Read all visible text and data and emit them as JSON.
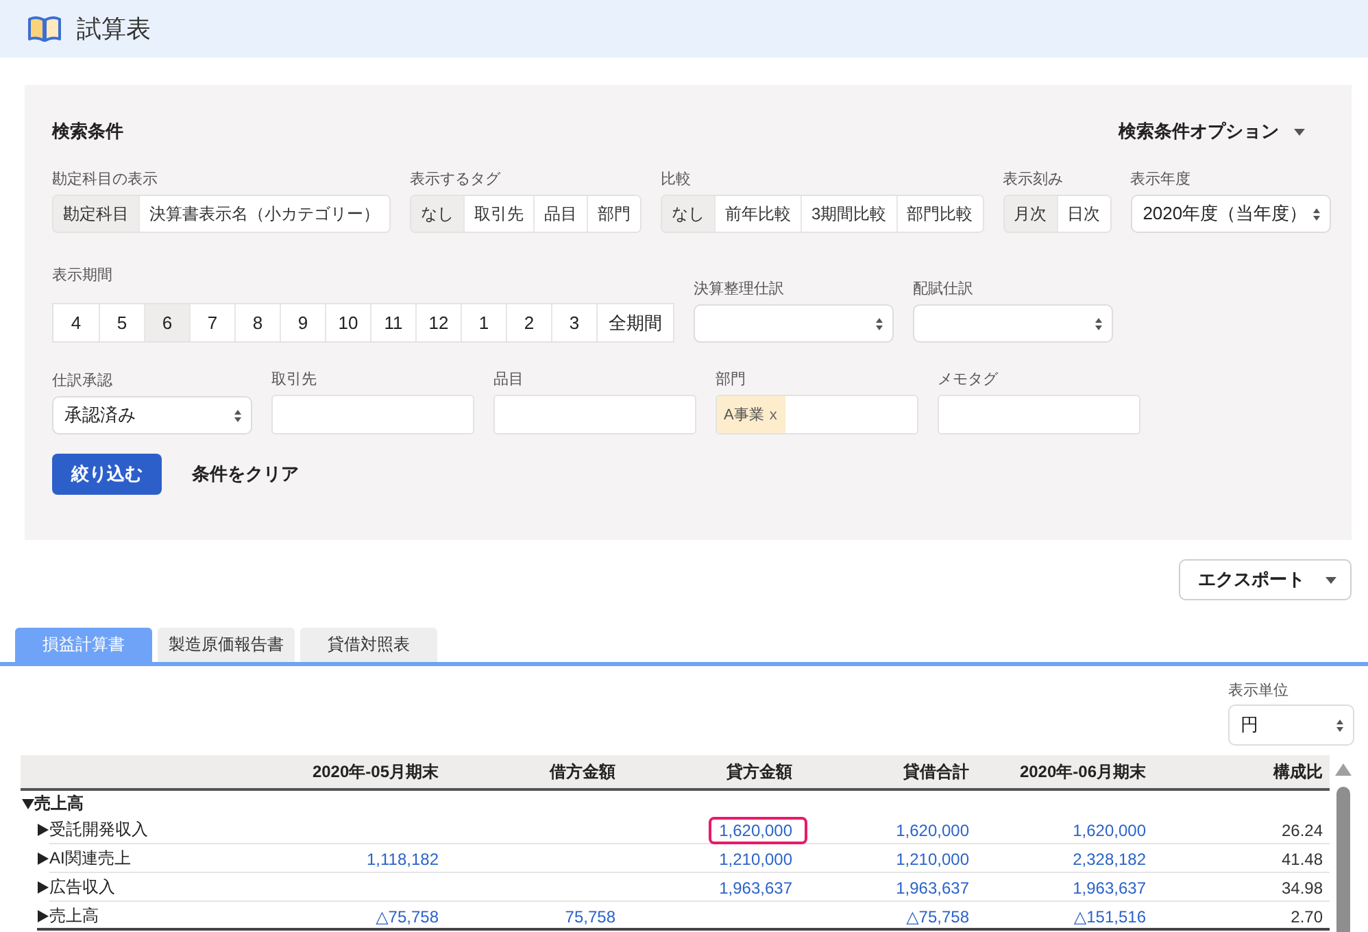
{
  "header": {
    "title": "試算表"
  },
  "search": {
    "title": "検索条件",
    "options_toggle": "検索条件オプション",
    "rows": [
      {
        "fields": [
          {
            "kind": "segmented",
            "label": "勘定科目の表示",
            "options": [
              {
                "label": "勘定科目",
                "selected": true
              },
              {
                "label": "決算書表示名（小カテゴリー）",
                "selected": false
              }
            ]
          },
          {
            "kind": "segmented",
            "label": "表示するタグ",
            "options": [
              {
                "label": "なし",
                "selected": true
              },
              {
                "label": "取引先",
                "selected": false
              },
              {
                "label": "品目",
                "selected": false
              },
              {
                "label": "部門",
                "selected": false
              }
            ]
          },
          {
            "kind": "segmented",
            "label": "比較",
            "options": [
              {
                "label": "なし",
                "selected": true
              },
              {
                "label": "前年比較",
                "selected": false
              },
              {
                "label": "3期間比較",
                "selected": false
              },
              {
                "label": "部門比較",
                "selected": false
              }
            ]
          },
          {
            "kind": "segmented",
            "label": "表示刻み",
            "options": [
              {
                "label": "月次",
                "selected": true
              },
              {
                "label": "日次",
                "selected": false
              }
            ]
          },
          {
            "kind": "select",
            "label": "表示年度",
            "value": "2020年度（当年度）"
          }
        ]
      },
      {
        "fields": [
          {
            "kind": "period",
            "label": "表示期間",
            "options": [
              {
                "label": "4",
                "selected": false
              },
              {
                "label": "5",
                "selected": false
              },
              {
                "label": "6",
                "selected": true
              },
              {
                "label": "7",
                "selected": false
              },
              {
                "label": "8",
                "selected": false
              },
              {
                "label": "9",
                "selected": false
              },
              {
                "label": "10",
                "selected": false
              },
              {
                "label": "11",
                "selected": false
              },
              {
                "label": "12",
                "selected": false
              },
              {
                "label": "1",
                "selected": false
              },
              {
                "label": "2",
                "selected": false
              },
              {
                "label": "3",
                "selected": false
              },
              {
                "label": "全期間",
                "selected": false
              }
            ]
          },
          {
            "kind": "select",
            "label": "決算整理仕訳"
          },
          {
            "kind": "select",
            "label": "配賦仕訳"
          }
        ]
      },
      {
        "fields": [
          {
            "kind": "select",
            "label": "仕訳承認",
            "value": "承認済み"
          },
          {
            "kind": "input",
            "label": "取引先"
          },
          {
            "kind": "input",
            "label": "品目"
          },
          {
            "kind": "tags",
            "label": "部門",
            "tags": [
              {
                "label": "A事業",
                "remove": "x"
              }
            ]
          },
          {
            "kind": "input",
            "label": "メモタグ"
          }
        ]
      }
    ],
    "apply_button": "絞り込む",
    "clear_button": "条件をクリア"
  },
  "export_button": "エクスポート",
  "tabs": [
    {
      "label": "損益計算書",
      "selected": true
    },
    {
      "label": "製造原価報告書",
      "selected": false
    },
    {
      "label": "貸借対照表",
      "selected": false
    }
  ],
  "unit": {
    "label": "表示単位",
    "value": "円"
  },
  "table": {
    "columns": [
      {
        "label": "2020年-05月期末",
        "kind": "amount"
      },
      {
        "label": "借方金額",
        "kind": "amount"
      },
      {
        "label": "貸方金額",
        "kind": "amount"
      },
      {
        "label": "貸借合計",
        "kind": "amount"
      },
      {
        "label": "2020年-06月期末",
        "kind": "amount"
      },
      {
        "label": "構成比",
        "kind": "ratio"
      }
    ],
    "rows": [
      {
        "label": "売上高",
        "expanded": true,
        "children": [
          {
            "label": "受託開発収入",
            "expanded": false,
            "cells": [
              null,
              null,
              {
                "text": "1,620,000",
                "circled": true
              },
              {
                "text": "1,620,000",
                "circled": false
              },
              {
                "text": "1,620,000",
                "circled": false
              },
              {
                "text": "26.24",
                "circled": false
              }
            ]
          },
          {
            "label": "AI関連売上",
            "expanded": false,
            "cells": [
              {
                "text": "1,118,182",
                "circled": false
              },
              null,
              {
                "text": "1,210,000",
                "circled": false
              },
              {
                "text": "1,210,000",
                "circled": false
              },
              {
                "text": "2,328,182",
                "circled": false
              },
              {
                "text": "41.48",
                "circled": false
              }
            ]
          },
          {
            "label": "広告収入",
            "expanded": false,
            "cells": [
              null,
              null,
              {
                "text": "1,963,637",
                "circled": false
              },
              {
                "text": "1,963,637",
                "circled": false
              },
              {
                "text": "1,963,637",
                "circled": false
              },
              {
                "text": "34.98",
                "circled": false
              }
            ]
          },
          {
            "label": "売上高",
            "expanded": false,
            "cells": [
              {
                "text": "△75,758",
                "circled": false
              },
              {
                "text": "75,758",
                "circled": false
              },
              null,
              {
                "text": "△75,758",
                "circled": false
              },
              {
                "text": "△151,516",
                "circled": false
              },
              {
                "text": "2.70",
                "circled": false
              }
            ]
          }
        ]
      }
    ]
  }
}
